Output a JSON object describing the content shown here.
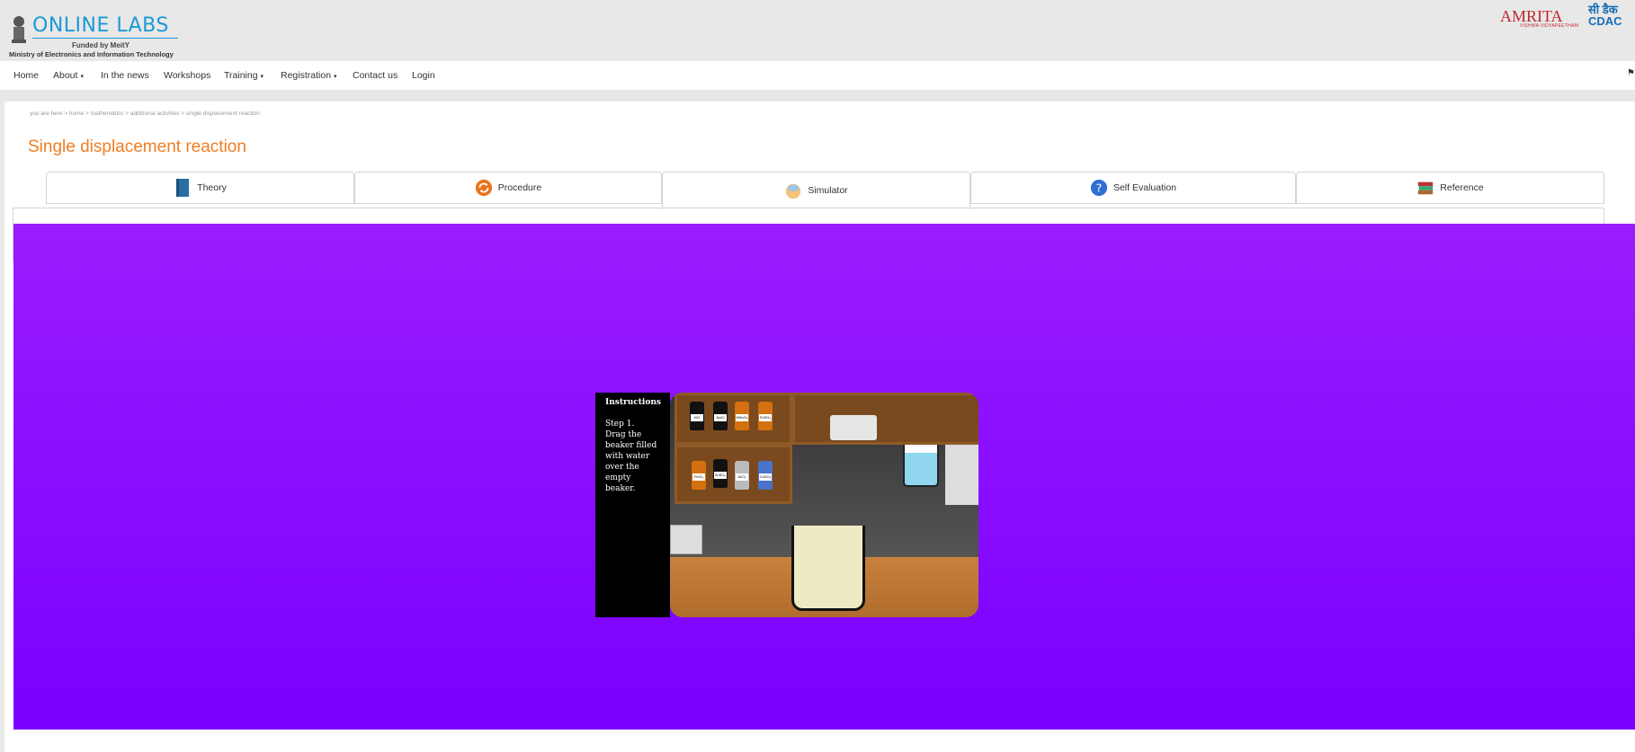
{
  "header": {
    "brand": "ONLINE LABS",
    "funded": "Funded by MeitY",
    "ministry": "Ministry of Electronics and Information Technology",
    "partner1": "AMRITA",
    "partner1_sub": "VISHWA VIDYAPEETHAM",
    "partner2_line1": "सी डैक",
    "partner2_line2": "CDAC"
  },
  "nav": {
    "items": [
      {
        "label": "Home"
      },
      {
        "label": "About"
      },
      {
        "label": "In the news"
      },
      {
        "label": "Workshops"
      },
      {
        "label": "Training"
      },
      {
        "label": "Registration"
      },
      {
        "label": "Contact us"
      },
      {
        "label": "Login"
      }
    ],
    "caret": "▾",
    "flag": "⚑"
  },
  "breadcrumb": "you are here > home > mathematics > additional activities > single displacement reaction",
  "page_title": "Single displacement reaction",
  "tabs": [
    {
      "label": "Theory"
    },
    {
      "label": "Procedure"
    },
    {
      "label": "Simulator",
      "active": true
    },
    {
      "label": "Self Evaluation"
    },
    {
      "label": "Reference"
    }
  ],
  "simulator": {
    "instructions_title": "Instructions",
    "instructions_step": "Step 1.",
    "instructions_text": "Drag the beaker filled with water over the empty beaker.",
    "bottles_top": [
      "HCl",
      "NaCl",
      "KMnO₄",
      "FeSO₄"
    ],
    "bottles_bottom": [
      "FeCl₃",
      "ZnSO₄",
      "AlCl₃",
      "CuSO₄"
    ]
  }
}
